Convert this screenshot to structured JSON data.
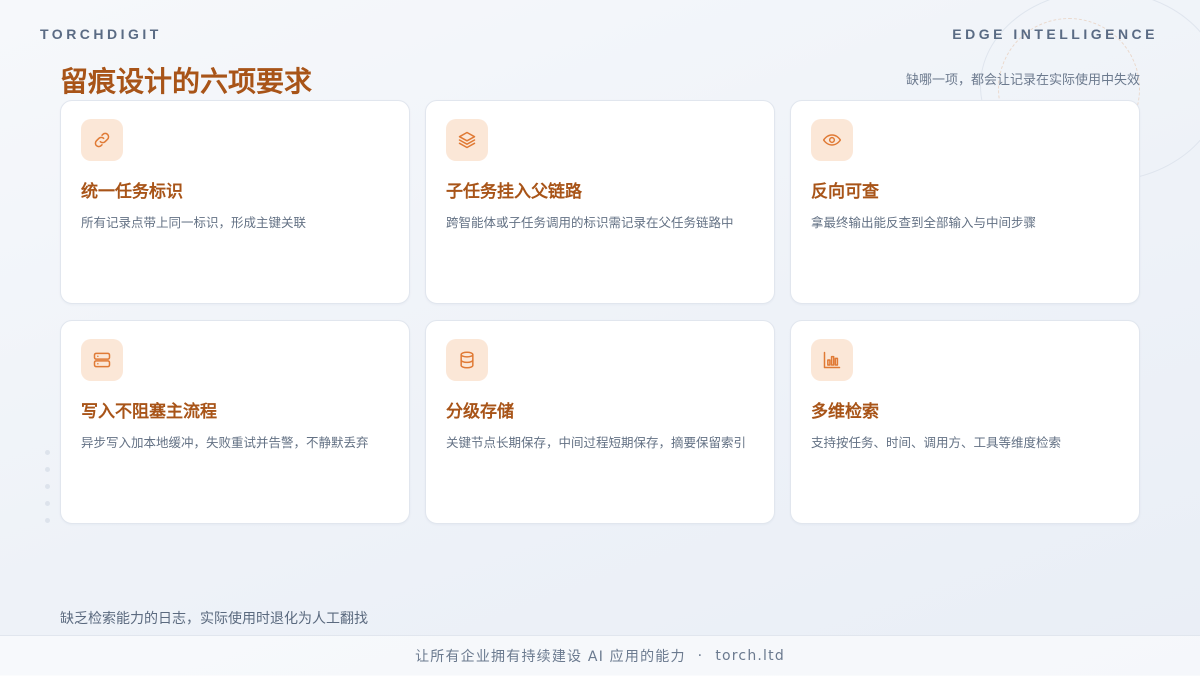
{
  "header": {
    "brand_left": "TORCHDIGIT",
    "brand_right": "EDGE INTELLIGENCE",
    "title": "留痕设计的六项要求",
    "subtitle": "缺哪一项，都会让记录在实际使用中失效"
  },
  "cards": [
    {
      "icon": "link-icon",
      "title": "统一任务标识",
      "desc": "所有记录点带上同一标识，形成主键关联"
    },
    {
      "icon": "layers-icon",
      "title": "子任务挂入父链路",
      "desc": "跨智能体或子任务调用的标识需记录在父任务链路中"
    },
    {
      "icon": "eye-icon",
      "title": "反向可查",
      "desc": "拿最终输出能反查到全部输入与中间步骤"
    },
    {
      "icon": "server-icon",
      "title": "写入不阻塞主流程",
      "desc": "异步写入加本地缓冲，失败重试并告警，不静默丢弃"
    },
    {
      "icon": "database-icon",
      "title": "分级存储",
      "desc": "关键节点长期保存，中间过程短期保存，摘要保留索引"
    },
    {
      "icon": "bar-chart-icon",
      "title": "多维检索",
      "desc": "支持按任务、时间、调用方、工具等维度检索"
    }
  ],
  "bottom_note": "缺乏检索能力的日志，实际使用时退化为人工翻找",
  "footer": {
    "slogan": "让所有企业拥有持续建设 AI 应用的能力",
    "separator": "·",
    "site": "torch.ltd"
  },
  "colors": {
    "accent": "#a85418",
    "icon_stroke": "#e07a35",
    "icon_bg": "#fbe7d7"
  }
}
